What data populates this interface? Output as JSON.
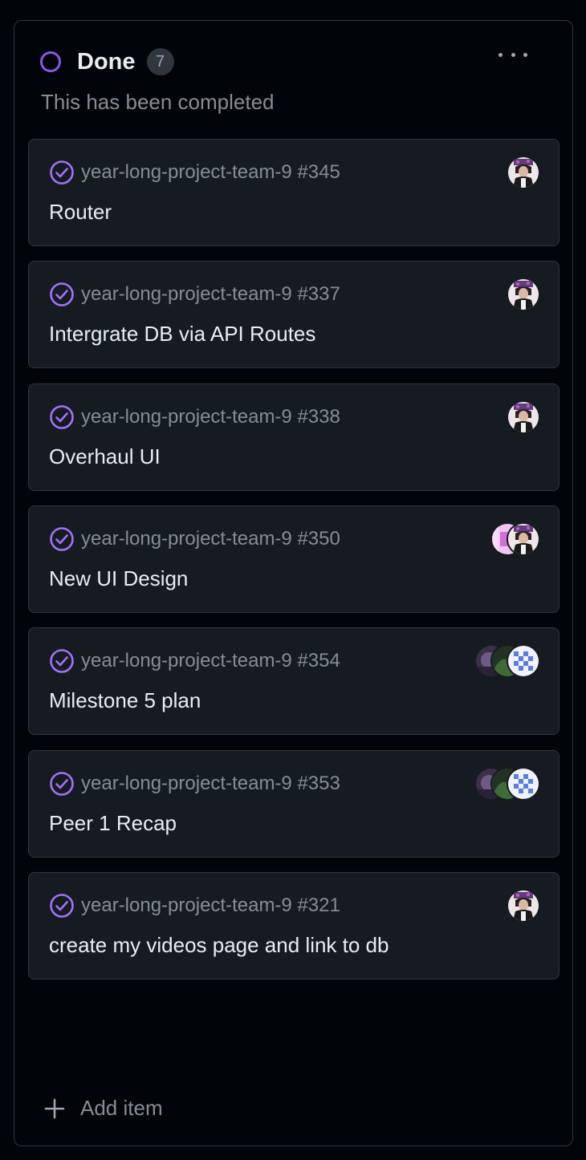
{
  "column": {
    "title": "Done",
    "count": "7",
    "description": "This has been completed",
    "status_color": "#8957e5",
    "add_item_label": "Add item"
  },
  "cards": [
    {
      "meta": "year-long-project-team-9 #345",
      "title": "Router",
      "avatars": [
        "portrait"
      ]
    },
    {
      "meta": "year-long-project-team-9 #337",
      "title": "Intergrate DB via API Routes",
      "avatars": [
        "portrait"
      ]
    },
    {
      "meta": "year-long-project-team-9 #338",
      "title": "Overhaul UI",
      "avatars": [
        "portrait"
      ]
    },
    {
      "meta": "year-long-project-team-9 #350",
      "title": "New UI Design",
      "avatars": [
        "portrait",
        "pink"
      ]
    },
    {
      "meta": "year-long-project-team-9 #354",
      "title": "Milestone 5 plan",
      "avatars": [
        "pattern",
        "green",
        "purple"
      ]
    },
    {
      "meta": "year-long-project-team-9 #353",
      "title": "Peer 1 Recap",
      "avatars": [
        "pattern",
        "green",
        "purple"
      ]
    },
    {
      "meta": "year-long-project-team-9 #321",
      "title": "create my videos page and link to db",
      "avatars": [
        "portrait"
      ]
    }
  ]
}
